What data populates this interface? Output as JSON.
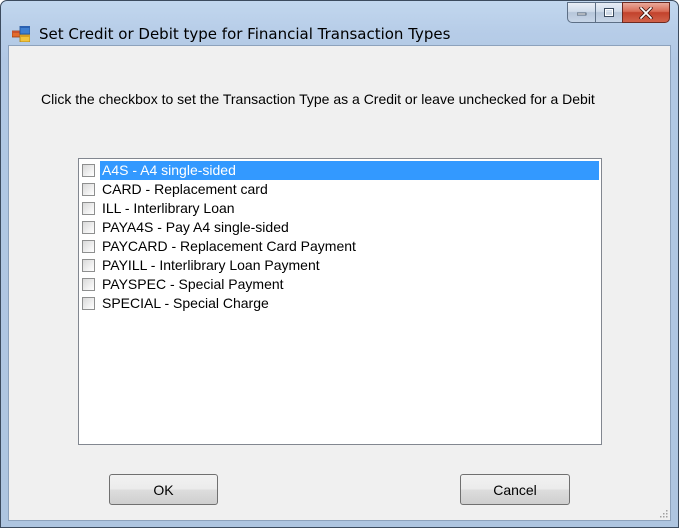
{
  "window": {
    "title": "Set Credit or Debit type for Financial Transaction Types",
    "icon": "form-icon",
    "caption_buttons": [
      "minimize-icon",
      "maximize-icon",
      "close-icon"
    ]
  },
  "instruction": "Click the checkbox to set the Transaction Type as a Credit or leave unchecked for a Debit",
  "transaction_types": [
    {
      "label": "A4S - A4 single-sided",
      "checked": false,
      "selected": true
    },
    {
      "label": "CARD - Replacement card",
      "checked": false,
      "selected": false
    },
    {
      "label": "ILL - Interlibrary Loan",
      "checked": false,
      "selected": false
    },
    {
      "label": "PAYA4S - Pay A4 single-sided",
      "checked": false,
      "selected": false
    },
    {
      "label": "PAYCARD - Replacement Card Payment",
      "checked": false,
      "selected": false
    },
    {
      "label": "PAYILL - Interlibrary Loan Payment",
      "checked": false,
      "selected": false
    },
    {
      "label": "PAYSPEC - Special Payment",
      "checked": false,
      "selected": false
    },
    {
      "label": "SPECIAL - Special Charge",
      "checked": false,
      "selected": false
    }
  ],
  "buttons": {
    "ok": "OK",
    "cancel": "Cancel"
  },
  "colors": {
    "selection": "#3399ff",
    "titlebar": "#b9cfe9",
    "client": "#f0f0f0"
  }
}
